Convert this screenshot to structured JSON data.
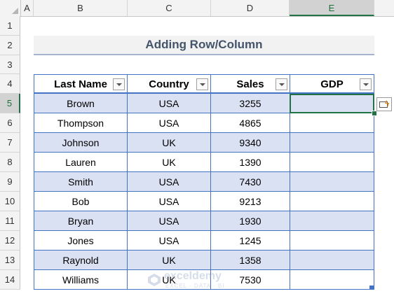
{
  "columns": [
    "A",
    "B",
    "C",
    "D",
    "E"
  ],
  "rows": [
    "1",
    "2",
    "3",
    "4",
    "5",
    "6",
    "7",
    "8",
    "9",
    "10",
    "11",
    "12",
    "13",
    "14"
  ],
  "title": "Adding Row/Column",
  "table": {
    "headers": [
      "Last Name",
      "Country",
      "Sales",
      "GDP"
    ],
    "rows": [
      {
        "last_name": "Brown",
        "country": "USA",
        "sales": "3255",
        "gdp": ""
      },
      {
        "last_name": "Thompson",
        "country": "USA",
        "sales": "4865",
        "gdp": ""
      },
      {
        "last_name": "Johnson",
        "country": "UK",
        "sales": "9340",
        "gdp": ""
      },
      {
        "last_name": "Lauren",
        "country": "UK",
        "sales": "1390",
        "gdp": ""
      },
      {
        "last_name": "Smith",
        "country": "USA",
        "sales": "7430",
        "gdp": ""
      },
      {
        "last_name": "Bob",
        "country": "USA",
        "sales": "9213",
        "gdp": ""
      },
      {
        "last_name": "Bryan",
        "country": "USA",
        "sales": "1930",
        "gdp": ""
      },
      {
        "last_name": "Jones",
        "country": "USA",
        "sales": "1245",
        "gdp": ""
      },
      {
        "last_name": "Raynold",
        "country": "UK",
        "sales": "1358",
        "gdp": ""
      },
      {
        "last_name": "Williams",
        "country": "UK",
        "sales": "7530",
        "gdp": ""
      }
    ]
  },
  "selection": {
    "column": "E",
    "row": "5"
  },
  "watermark": {
    "name": "exceldemy",
    "tagline": "EXCEL · DATA · BI"
  },
  "colors": {
    "accent": "#217346",
    "table_border": "#4472c4",
    "band": "#d9e1f2",
    "title_text": "#44546a"
  }
}
